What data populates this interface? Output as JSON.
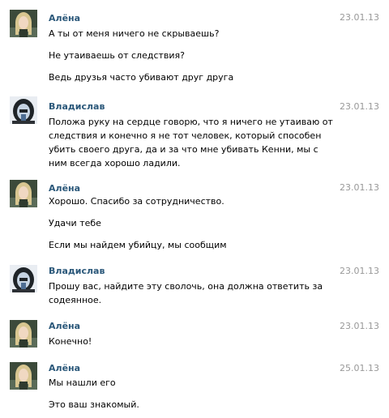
{
  "messages": [
    {
      "author": "Алёна",
      "date": "23.01.13",
      "lines": [
        "А ты от меня ничего не скрываешь?",
        "Не утаиваешь от следствия?",
        "Ведь друзья часто убивают друг друга"
      ]
    },
    {
      "author": "Владислав",
      "date": "23.01.13",
      "lines": [
        "Положа руку на сердце говорю, что я ничего не утаиваю от следствия и конечно я не тот человек, который способен убить своего друга, да и за что мне убивать Кенни, мы с ним всегда хорошо ладили."
      ]
    },
    {
      "author": "Алёна",
      "date": "23.01.13",
      "lines": [
        "Хорошо. Спасибо за сотрудничество.",
        "Удачи тебе",
        "Если мы найдем убийцу, мы сообщим"
      ]
    },
    {
      "author": "Владислав",
      "date": "23.01.13",
      "lines": [
        "Прошу вас, найдите эту сволочь, она должна ответить за содеянное."
      ]
    },
    {
      "author": "Алёна",
      "date": "23.01.13",
      "lines": [
        "Конечно!"
      ]
    },
    {
      "author": "Алёна",
      "date": "25.01.13",
      "lines": [
        "Мы нашли его",
        "Это ваш знакомый."
      ]
    }
  ]
}
